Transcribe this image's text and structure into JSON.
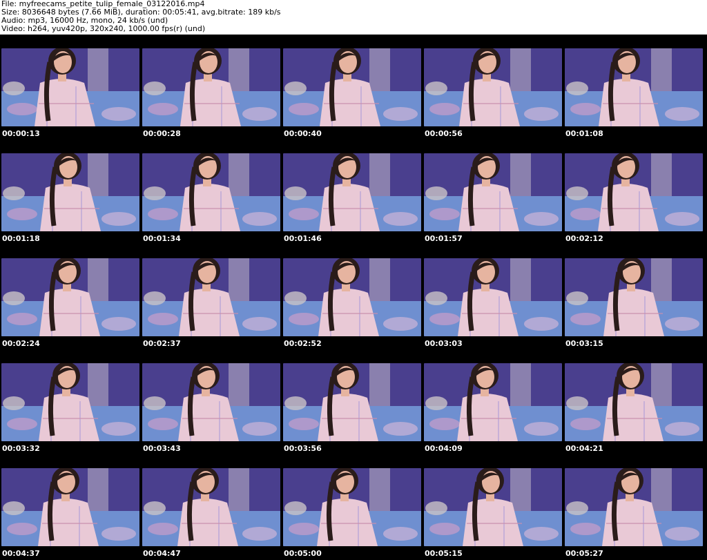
{
  "header": {
    "file": "File: myfreecams_petite_tulip_female_03122016.mp4",
    "size": "Size: 8036648 bytes (7.66 MiB), duration: 00:05:41, avg.bitrate: 189 kb/s",
    "audio": "Audio: mp3, 16000 Hz, mono, 24 kb/s (und)",
    "video": "Video: h264, yuv420p, 320x240, 1000.00 fps(r) (und)"
  },
  "colors": {
    "page_bg": "#000000",
    "header_bg": "#ffffff",
    "wall": "#4a3f8e",
    "blanket": "#6f8fd0",
    "shirt": "#e9c9d6",
    "hair": "#2a1c1a",
    "skin": "#e6b4a0"
  },
  "frames": [
    {
      "time": "00:00:13"
    },
    {
      "time": "00:00:28"
    },
    {
      "time": "00:00:40"
    },
    {
      "time": "00:00:56"
    },
    {
      "time": "00:01:08"
    },
    {
      "time": "00:01:18"
    },
    {
      "time": "00:01:34"
    },
    {
      "time": "00:01:46"
    },
    {
      "time": "00:01:57"
    },
    {
      "time": "00:02:12"
    },
    {
      "time": "00:02:24"
    },
    {
      "time": "00:02:37"
    },
    {
      "time": "00:02:52"
    },
    {
      "time": "00:03:03"
    },
    {
      "time": "00:03:15"
    },
    {
      "time": "00:03:32"
    },
    {
      "time": "00:03:43"
    },
    {
      "time": "00:03:56"
    },
    {
      "time": "00:04:09"
    },
    {
      "time": "00:04:21"
    },
    {
      "time": "00:04:37"
    },
    {
      "time": "00:04:47"
    },
    {
      "time": "00:05:00"
    },
    {
      "time": "00:05:15"
    },
    {
      "time": "00:05:27"
    }
  ]
}
